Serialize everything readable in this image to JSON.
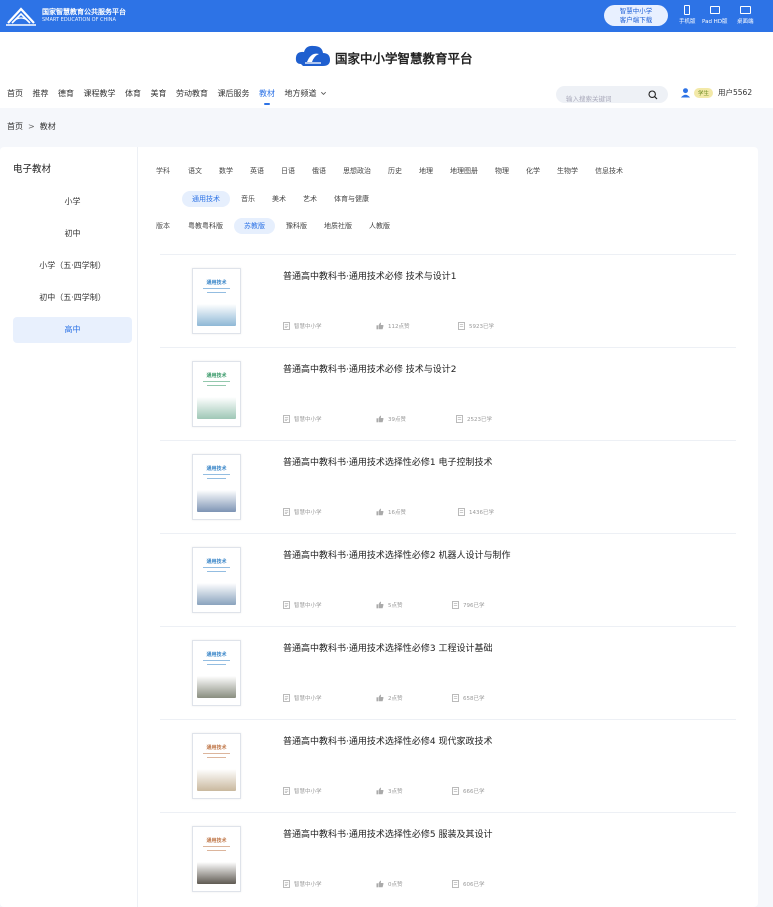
{
  "topbar": {
    "org_cn": "国家智慧教育公共服务平台",
    "org_en": "SMART EDUCATION OF CHINA",
    "download_line1": "智慧中小学",
    "download_line2": "客户端下载",
    "devices": [
      {
        "label": "手机版",
        "icon": "phone-icon"
      },
      {
        "label": "Pad HD版",
        "icon": "tablet-icon"
      },
      {
        "label": "桌面端",
        "icon": "desktop-icon"
      }
    ],
    "color": "#2d73e6"
  },
  "header": {
    "brand": "国家中小学智慧教育平台",
    "nav": [
      {
        "label": "首页",
        "active": false
      },
      {
        "label": "推荐",
        "active": false
      },
      {
        "label": "德育",
        "active": false
      },
      {
        "label": "课程教学",
        "active": false
      },
      {
        "label": "体育",
        "active": false
      },
      {
        "label": "美育",
        "active": false
      },
      {
        "label": "劳动教育",
        "active": false
      },
      {
        "label": "课后服务",
        "active": false
      },
      {
        "label": "教材",
        "active": true
      },
      {
        "label": "地方频道",
        "active": false
      }
    ],
    "search_placeholder": "输入搜索关键词",
    "role": "学生",
    "username": "用户5562"
  },
  "breadcrumb": {
    "home": "首页",
    "sep": ">",
    "current": "教材"
  },
  "sidebar": {
    "title": "电子教材",
    "items": [
      {
        "label": "小学",
        "active": false
      },
      {
        "label": "初中",
        "active": false
      },
      {
        "label": "小学（五·四学制）",
        "active": false
      },
      {
        "label": "初中（五·四学制）",
        "active": false
      },
      {
        "label": "高中",
        "active": true
      }
    ]
  },
  "filters": {
    "subject_label": "学科",
    "subjects_row1": [
      "语文",
      "数学",
      "英语",
      "日语",
      "俄语",
      "思想政治",
      "历史",
      "地理",
      "地理图册",
      "物理",
      "化学",
      "生物学",
      "信息技术"
    ],
    "subjects_row2": [
      "通用技术",
      "音乐",
      "美术",
      "艺术",
      "体育与健康"
    ],
    "subject_selected": "通用技术",
    "edition_label": "版本",
    "editions": [
      "粤教粤科版",
      "苏教版",
      "豫科版",
      "地质社版",
      "人教版"
    ],
    "edition_selected": "苏教版"
  },
  "books": [
    {
      "title": "普通高中教科书·通用技术必修 技术与设计1",
      "publisher": "智慧中小学",
      "likes": "112点赞",
      "learners": "5923已学",
      "cover_title": "通用技术",
      "cover_color": "#3a86c8",
      "cover_image_tint": "#8fb8d6"
    },
    {
      "title": "普通高中教科书·通用技术必修 技术与设计2",
      "publisher": "智慧中小学",
      "likes": "39点赞",
      "learners": "2523已学",
      "cover_title": "通用技术",
      "cover_color": "#3a9a6a",
      "cover_image_tint": "#9fc7b6"
    },
    {
      "title": "普通高中教科书·通用技术选择性必修1 电子控制技术",
      "publisher": "智慧中小学",
      "likes": "16点赞",
      "learners": "1436已学",
      "cover_title": "通用技术",
      "cover_color": "#3a86c8",
      "cover_image_tint": "#7d94b4"
    },
    {
      "title": "普通高中教科书·通用技术选择性必修2 机器人设计与制作",
      "publisher": "智慧中小学",
      "likes": "5点赞",
      "learners": "796已学",
      "cover_title": "通用技术",
      "cover_color": "#3a86c8",
      "cover_image_tint": "#8aa3bd"
    },
    {
      "title": "普通高中教科书·通用技术选择性必修3 工程设计基础",
      "publisher": "智慧中小学",
      "likes": "2点赞",
      "learners": "658已学",
      "cover_title": "通用技术",
      "cover_color": "#3a86c8",
      "cover_image_tint": "#8a8e80"
    },
    {
      "title": "普通高中教科书·通用技术选择性必修4 现代家政技术",
      "publisher": "智慧中小学",
      "likes": "3点赞",
      "learners": "666已学",
      "cover_title": "通用技术",
      "cover_color": "#c0784a",
      "cover_image_tint": "#c9b89e"
    },
    {
      "title": "普通高中教科书·通用技术选择性必修5 服装及其设计",
      "publisher": "智慧中小学",
      "likes": "0点赞",
      "learners": "606已学",
      "cover_title": "通用技术",
      "cover_color": "#c0784a",
      "cover_image_tint": "#5f5a52"
    }
  ]
}
